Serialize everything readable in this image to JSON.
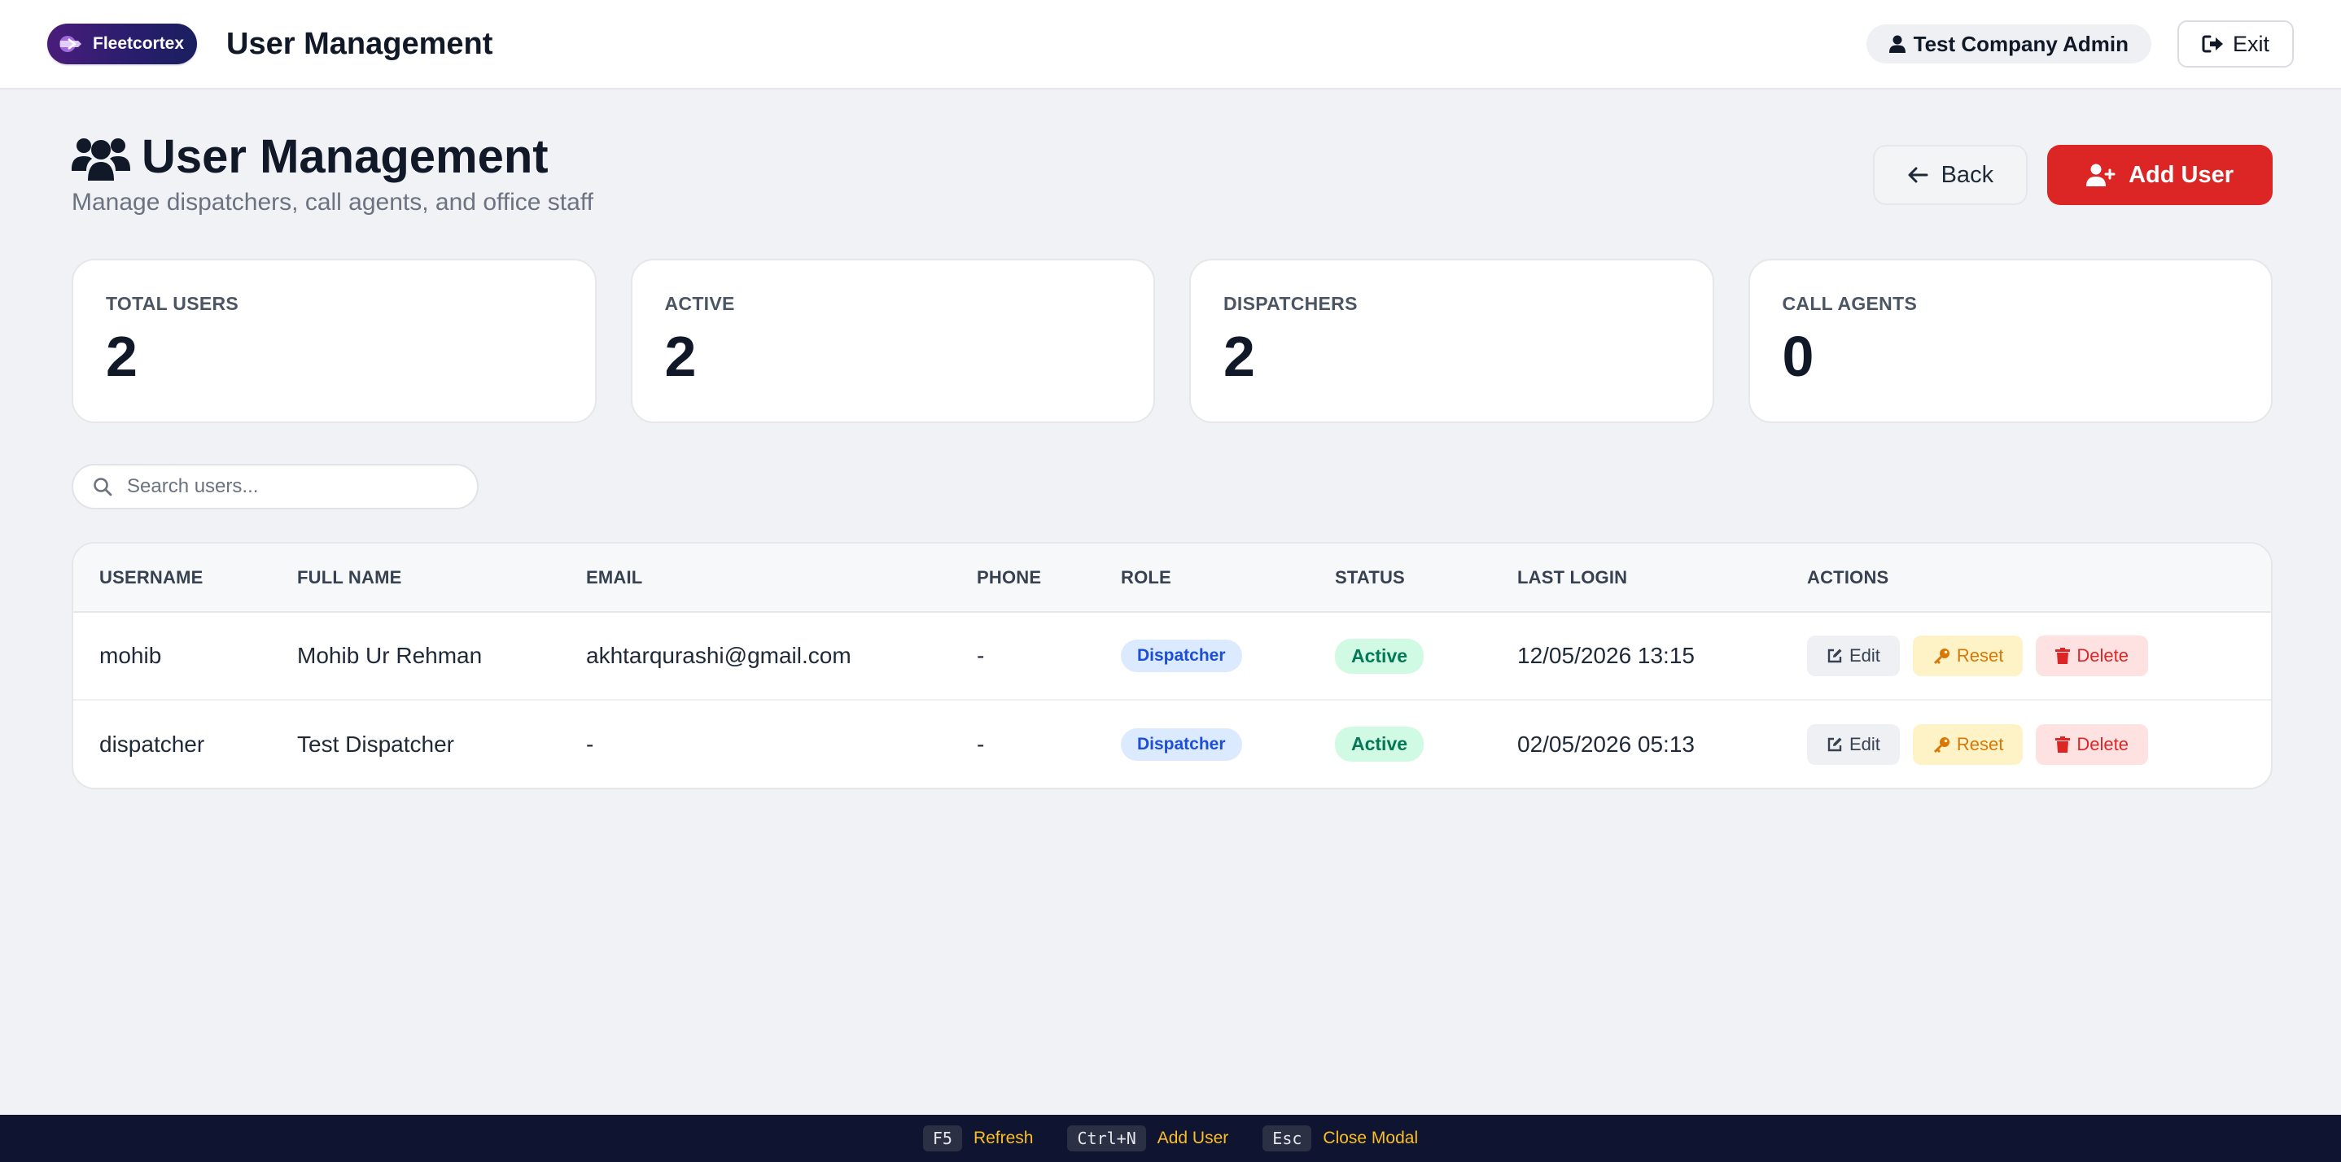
{
  "topbar": {
    "logo_text": "Fleetcortex",
    "title": "User Management",
    "user_name": "Test Company Admin",
    "exit_label": "Exit"
  },
  "header": {
    "title": "User Management",
    "subtitle": "Manage dispatchers, call agents, and office staff",
    "back_label": "Back",
    "add_label": "Add User"
  },
  "stats": [
    {
      "label": "TOTAL USERS",
      "value": "2"
    },
    {
      "label": "ACTIVE",
      "value": "2"
    },
    {
      "label": "DISPATCHERS",
      "value": "2"
    },
    {
      "label": "CALL AGENTS",
      "value": "0"
    }
  ],
  "search": {
    "placeholder": "Search users...",
    "value": ""
  },
  "table": {
    "columns": [
      "USERNAME",
      "FULL NAME",
      "EMAIL",
      "PHONE",
      "ROLE",
      "STATUS",
      "LAST LOGIN",
      "ACTIONS"
    ],
    "rows": [
      {
        "username": "mohib",
        "full_name": "Mohib Ur Rehman",
        "email": "akhtarqurashi@gmail.com",
        "phone": "-",
        "role": "Dispatcher",
        "status": "Active",
        "last_login": "12/05/2026 13:15"
      },
      {
        "username": "dispatcher",
        "full_name": "Test Dispatcher",
        "email": "-",
        "phone": "-",
        "role": "Dispatcher",
        "status": "Active",
        "last_login": "02/05/2026 05:13"
      }
    ],
    "actions": {
      "edit": "Edit",
      "reset": "Reset",
      "delete": "Delete"
    }
  },
  "footer": {
    "hotkeys": [
      {
        "key": "F5",
        "label": "Refresh"
      },
      {
        "key": "Ctrl+N",
        "label": "Add User"
      },
      {
        "key": "Esc",
        "label": "Close Modal"
      }
    ]
  },
  "colors": {
    "accent_red": "#dc2626",
    "role_badge": "#dbeafe",
    "status_badge": "#d1fae5",
    "footer_bg": "#0f1530",
    "hotkey_label": "#fbbf24"
  },
  "icons": {
    "logo": "fleetcortex-logo-icon",
    "user": "user-icon",
    "exit": "sign-out-icon",
    "title": "users-icon",
    "back": "arrow-left-icon",
    "add": "user-plus-icon",
    "search": "search-icon",
    "edit": "edit-icon",
    "reset": "key-icon",
    "delete": "trash-icon"
  }
}
